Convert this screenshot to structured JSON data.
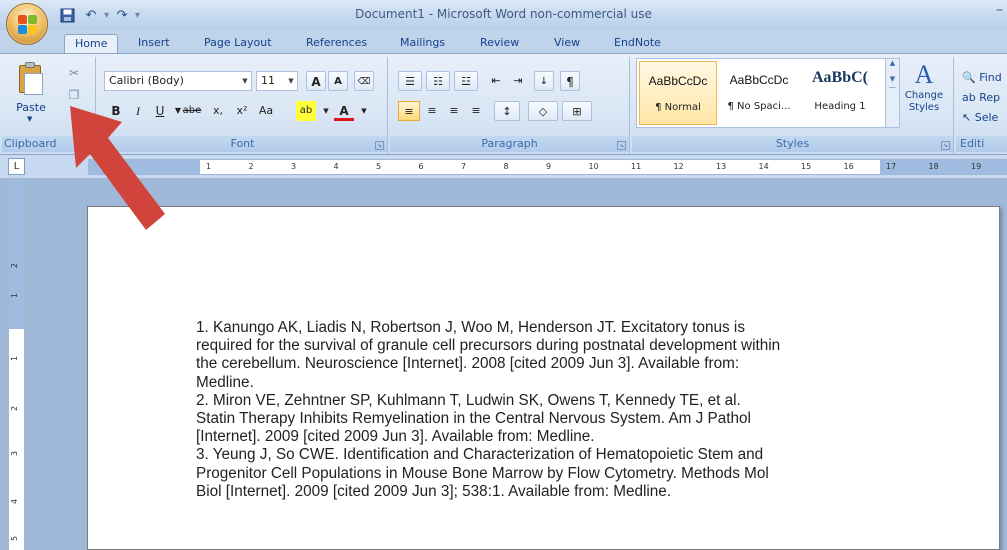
{
  "window": {
    "title": "Document1 - Microsoft Word non-commercial use",
    "minimize": "–"
  },
  "qat": {
    "undo_label": "↶",
    "redo_label": "↷",
    "more_label": "▾"
  },
  "tabs": [
    "Home",
    "Insert",
    "Page Layout",
    "References",
    "Mailings",
    "Review",
    "View",
    "EndNote"
  ],
  "ribbon": {
    "clipboard": {
      "paste_label": "Paste",
      "group_label": "Clipboard"
    },
    "font": {
      "font_name": "Calibri (Body)",
      "font_size": "11",
      "grow": "A",
      "shrink": "A",
      "bold": "B",
      "italic": "I",
      "underline": "U",
      "strike": "abe",
      "subscript": "x,",
      "superscript": "x²",
      "change_case": "Aa",
      "highlight": "ab",
      "font_color": "A",
      "group_label": "Font"
    },
    "paragraph": {
      "group_label": "Paragraph",
      "pilcrow": "¶"
    },
    "styles": {
      "items": [
        {
          "sample": "AaBbCcDc",
          "name": "¶ Normal"
        },
        {
          "sample": "AaBbCcDc",
          "name": "¶ No Spaci..."
        },
        {
          "sample": "AaBbC(",
          "name": "Heading 1"
        }
      ],
      "change_label": "Change Styles",
      "group_label": "Styles"
    },
    "editing": {
      "find": "Find",
      "replace": "Rep",
      "select": "Sele",
      "group_label": "Editi"
    }
  },
  "ruler": {
    "corner": "L",
    "ticks": [
      "1",
      "2",
      "3",
      "4",
      "5",
      "6",
      "7",
      "8",
      "9",
      "10",
      "11",
      "12",
      "13",
      "14",
      "15",
      "16",
      "17",
      "18",
      "19"
    ],
    "vticks": [
      "2",
      "1",
      "1",
      "2",
      "3",
      "4",
      "5"
    ]
  },
  "document": {
    "references": [
      {
        "lines": [
          "1.  Kanungo AK, Liadis N, Robertson J, Woo M, Henderson JT. Excitatory tonus is",
          "required for the survival of granule cell precursors during postnatal development within",
          "the cerebellum. Neuroscience [Internet]. 2008 [cited 2009 Jun 3]. Available from:",
          "Medline."
        ]
      },
      {
        "lines": [
          "2.  Miron VE, Zehntner SP, Kuhlmann T, Ludwin SK, Owens T, Kennedy TE, et al.",
          "Statin Therapy Inhibits Remyelination in the Central Nervous System. Am J Pathol",
          "[Internet]. 2009 [cited 2009 Jun 3]. Available from: Medline."
        ]
      },
      {
        "lines": [
          "3.  Yeung J, So CWE. Identification and Characterization of Hematopoietic Stem and",
          "Progenitor Cell Populations in Mouse Bone Marrow by Flow Cytometry. Methods Mol",
          "Biol [Internet]. 2009 [cited 2009 Jun 3]; 538:1. Available from: Medline."
        ]
      }
    ]
  },
  "colors": {
    "annotation_arrow": "#d1443c",
    "ribbon_text": "#15428b"
  }
}
